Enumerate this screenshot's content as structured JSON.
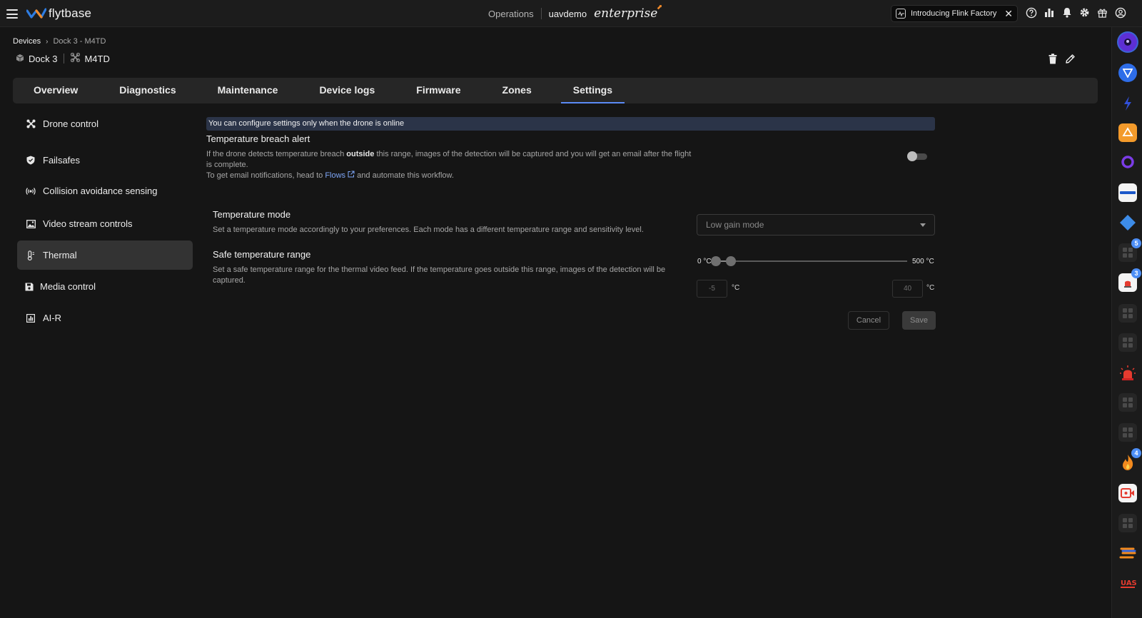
{
  "topbar": {
    "logo_text": "flytbase",
    "operations": "Operations",
    "org": "uavdemo",
    "edition": "enterprise",
    "promo_text": "Introducing Flink Factory",
    "promo_close": "✕"
  },
  "breadcrumb": {
    "root": "Devices",
    "separator": "›",
    "current": "Dock 3 - M4TD"
  },
  "device": {
    "dock": "Dock 3",
    "drone": "M4TD"
  },
  "tabs": [
    "Overview",
    "Diagnostics",
    "Maintenance",
    "Device logs",
    "Firmware",
    "Zones",
    "Settings"
  ],
  "active_tab": "Settings",
  "sidebar": {
    "items": [
      "Drone control",
      "Failsafes",
      "Collision avoidance sensing",
      "Video stream controls",
      "Thermal",
      "Media control",
      "AI-R"
    ],
    "active": "Thermal"
  },
  "notice": "You can configure settings only when the drone is online",
  "breach_alert": {
    "title": "Temperature breach alert",
    "desc_pre": "If the drone detects temperature breach ",
    "desc_bold": "outside",
    "desc_post": " this range, images of the detection will be captured and you will get an email after the flight is complete.",
    "email_pre": "To get email notifications, head to ",
    "email_link": "Flows",
    "email_post": " and automate this workflow.",
    "enabled": false
  },
  "temperature_mode": {
    "title": "Temperature mode",
    "desc": "Set a temperature mode accordingly to your preferences. Each mode has a different temperature range and sensitivity level.",
    "selected": "Low gain mode"
  },
  "safe_range": {
    "title": "Safe temperature range",
    "desc": "Set a safe temperature range for the thermal video feed. If the temperature goes outside this range, images of the detection will be captured.",
    "min_label": "0 °C",
    "max_label": "500 °C",
    "scale_min": 0,
    "scale_max": 500,
    "low_value": "-5",
    "high_value": "40",
    "unit": "°C"
  },
  "actions": {
    "cancel": "Cancel",
    "save": "Save"
  },
  "rail": {
    "badges": [
      "5",
      "3",
      "4"
    ]
  }
}
